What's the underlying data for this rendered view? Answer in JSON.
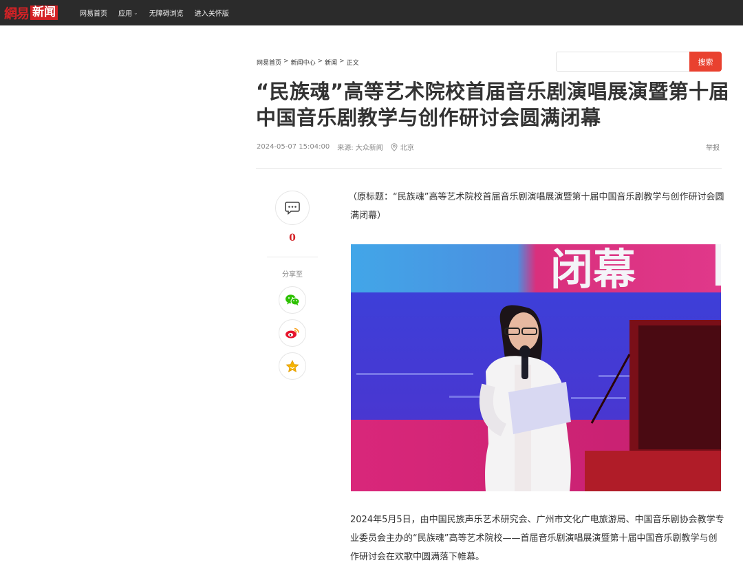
{
  "header": {
    "logo_wangyi": "網易",
    "logo_news": "新闻",
    "nav": [
      {
        "label": "网易首页"
      },
      {
        "label": "应用",
        "has_dropdown": true
      },
      {
        "label": "无障碍浏览"
      },
      {
        "label": "进入关怀版"
      }
    ]
  },
  "breadcrumb": {
    "items": [
      "网易首页",
      "新闻中心",
      "新闻",
      "正文"
    ],
    "separator": ">"
  },
  "search": {
    "placeholder": "",
    "button_label": "搜索"
  },
  "article": {
    "title": "“民族魂”高等艺术院校首届音乐剧演唱展演暨第十届中国音乐剧教学与创作研讨会圆满闭幕",
    "datetime": "2024-05-07 15:04:00",
    "source": "来源: 大众新闻",
    "location": "北京",
    "report_label": "举报",
    "original_title": "（原标题：“民族魂”高等艺术院校首届音乐剧演唱展演暨第十届中国音乐剧教学与创作研讨会圆满闭幕）",
    "photo_sign_text": "闭幕",
    "paragraph": "2024年5月5日，由中国民族声乐艺术研究会、广州市文化广电旅游局、中国音乐剧协会教学专业委员会主办的“民族魂”高等艺术院校——首届音乐剧演唱展演暨第十届中国音乐剧教学与创作研讨会在欢歌中圆满落下帷幕。"
  },
  "side": {
    "comment_count": "0",
    "share_label": "分享至",
    "share_targets": [
      "wechat-icon",
      "weibo-icon",
      "favorite-star-icon"
    ]
  },
  "colors": {
    "topbar": "#2b2b2b",
    "brand_red": "#d42226",
    "search_button": "#e9412f"
  }
}
